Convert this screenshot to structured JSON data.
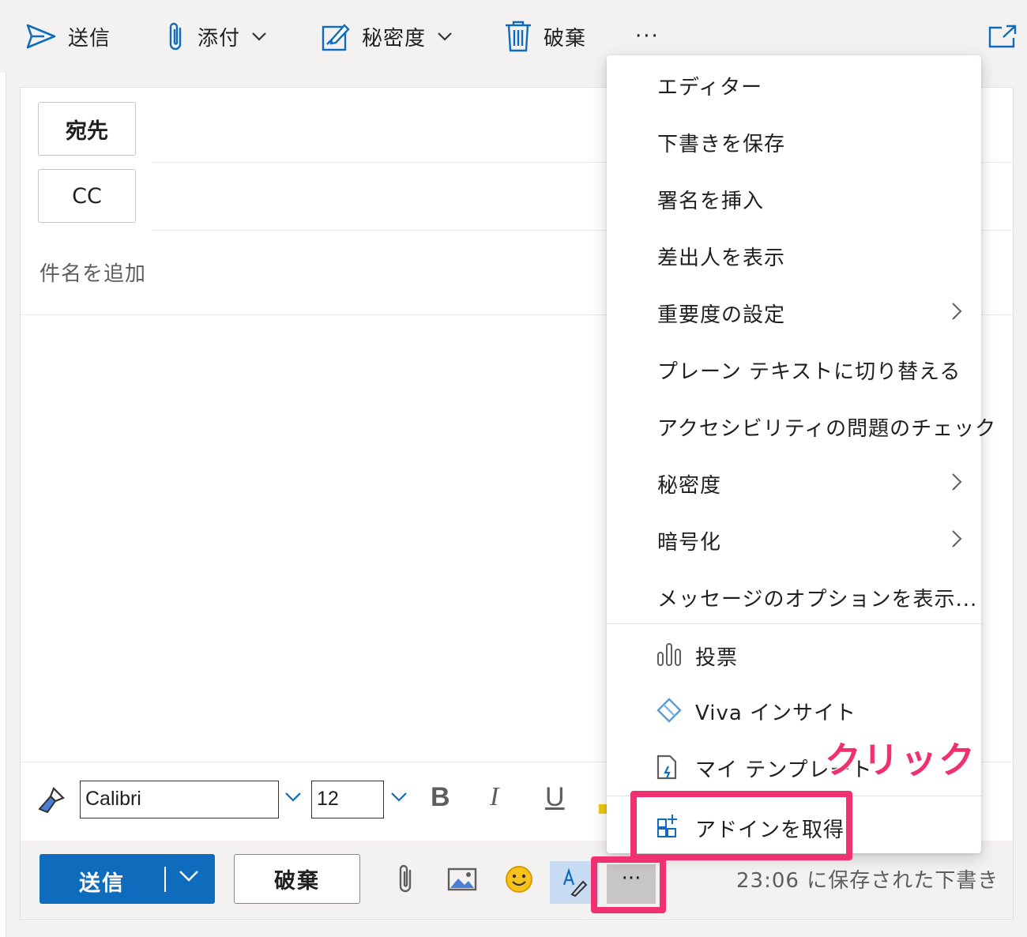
{
  "toolbar": {
    "send_label": "送信",
    "attach_label": "添付",
    "sensitivity_label": "秘密度",
    "discard_label": "破棄",
    "more_label": "···"
  },
  "compose": {
    "to_label": "宛先",
    "cc_label": "CC",
    "subject_placeholder": "件名を追加"
  },
  "format": {
    "font_name": "Calibri",
    "font_size": "12",
    "bold": "B",
    "italic": "I",
    "underline": "U"
  },
  "bottom": {
    "send_label": "送信",
    "discard_label": "破棄",
    "more_label": "···",
    "status": "23:06 に保存された下書き"
  },
  "menu": {
    "items": [
      {
        "label": "エディター",
        "has_submenu": false
      },
      {
        "label": "下書きを保存",
        "has_submenu": false
      },
      {
        "label": "署名を挿入",
        "has_submenu": false
      },
      {
        "label": "差出人を表示",
        "has_submenu": false
      },
      {
        "label": "重要度の設定",
        "has_submenu": true
      },
      {
        "label": "プレーン テキストに切り替える",
        "has_submenu": false
      },
      {
        "label": "アクセシビリティの問題のチェック",
        "has_submenu": false
      },
      {
        "label": "秘密度",
        "has_submenu": true
      },
      {
        "label": "暗号化",
        "has_submenu": true
      },
      {
        "label": "メッセージのオプションを表示...",
        "has_submenu": false
      }
    ],
    "addins": [
      {
        "label": "投票",
        "icon": "poll-icon"
      },
      {
        "label": "Viva インサイト",
        "icon": "viva-insights-icon"
      },
      {
        "label": "マイ テンプレート",
        "icon": "template-icon"
      }
    ],
    "get_addins_label": "アドインを取得"
  },
  "annotation": {
    "callout": "クリック",
    "color": "#f0306f"
  },
  "colors": {
    "accent": "#0f6cbd",
    "highlight": "#f0306f"
  }
}
